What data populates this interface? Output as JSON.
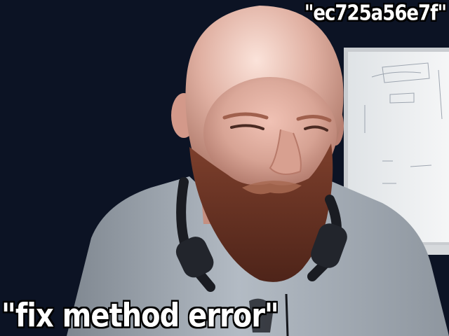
{
  "overlay": {
    "top_right_text": "\"ec725a56e7f\"",
    "bottom_left_text": "\"fix method error\""
  },
  "scene": {
    "subject": "webcam-portrait",
    "colors": {
      "background": "#0b1122",
      "whiteboard": "#eef0f2",
      "skin": "#d9a596",
      "beard": "#6b3424",
      "shirt": "#a9b1ba",
      "headphones": "#1a1c22"
    }
  }
}
